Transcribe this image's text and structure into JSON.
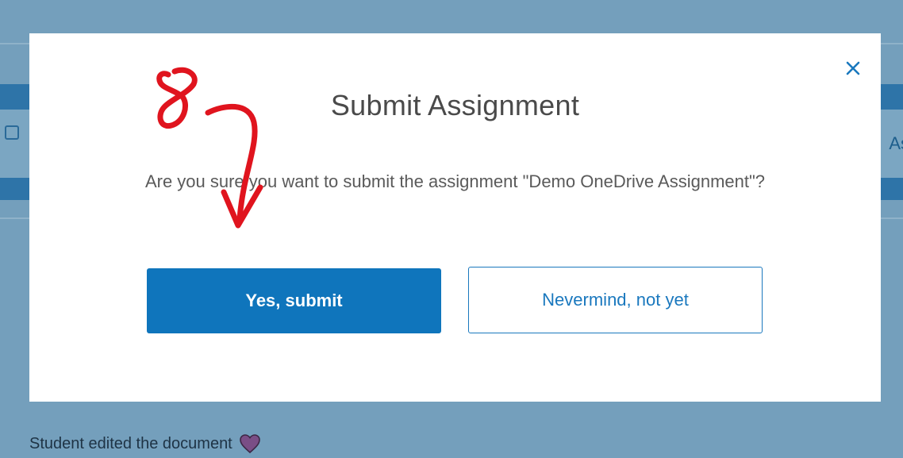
{
  "background": {
    "side_text": "As",
    "activity": {
      "text": "Student edited the document",
      "icon": "heart-icon"
    }
  },
  "modal": {
    "title": "Submit Assignment",
    "message": "Are you sure you want to submit the assignment \"Demo OneDrive Assignment\"?",
    "close_icon": "close-icon",
    "primary_button": "Yes, submit",
    "secondary_button": "Nevermind, not yet"
  },
  "annotation": {
    "label": "8",
    "icon": "arrow-down-icon",
    "color": "#e0141e"
  },
  "colors": {
    "overlay": "#749fbc",
    "primary": "#0f75bc",
    "annotation": "#e0141e"
  }
}
